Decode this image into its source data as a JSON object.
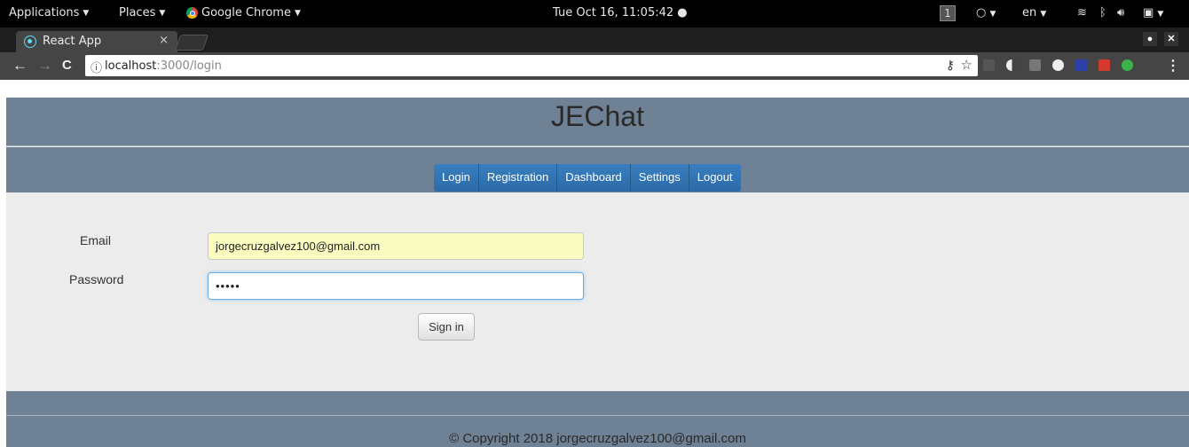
{
  "topbar": {
    "applications": "Applications",
    "places": "Places",
    "active_app": "Google Chrome",
    "clock": "Tue Oct 16, 11:05:42 ●",
    "workspace": "1",
    "language": "en"
  },
  "browser": {
    "tab_title": "React App",
    "tab_close": "×",
    "url_host": "localhost",
    "url_rest": ":3000/login",
    "menu": "⋮"
  },
  "site": {
    "brand": "JEChat",
    "nav": [
      "Login",
      "Registration",
      "Dashboard",
      "Settings",
      "Logout"
    ],
    "form": {
      "email_label": "Email",
      "email_value": "jorgecruzgalvez100@gmail.com",
      "password_label": "Password",
      "password_value": "•••••",
      "signin_label": "Sign in"
    },
    "footer": "© Copyright 2018 jorgecruzgalvez100@gmail.com"
  },
  "colors": {
    "header_bg": "#6f8194",
    "nav_bg": "#2d6ca2",
    "page_bg": "#ececec",
    "autofill_bg": "#fafdbf"
  }
}
